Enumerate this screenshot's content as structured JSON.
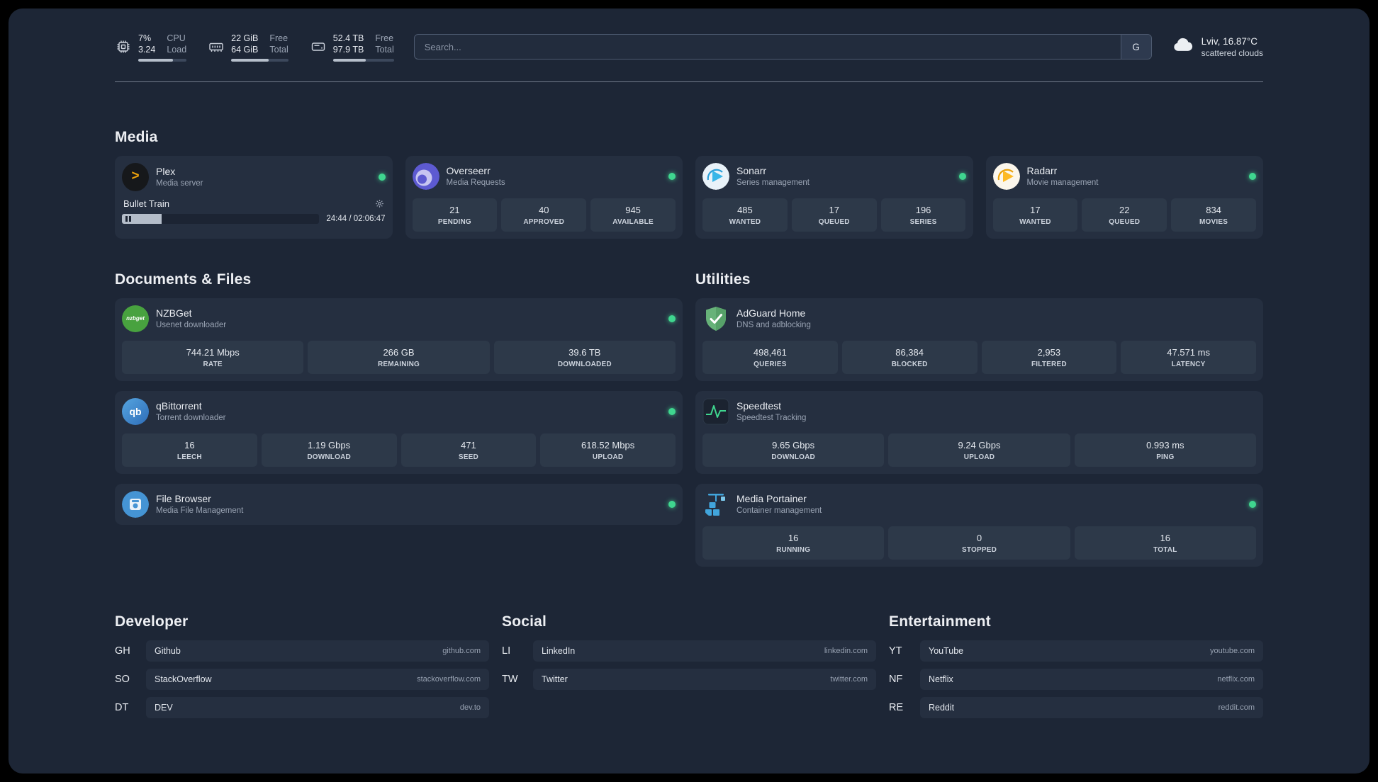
{
  "colors": {
    "status_online": "#3fd68f",
    "plex_accent": "#eba10c"
  },
  "topbar": {
    "cpu": {
      "percent": "7%",
      "load": "3.24",
      "label_top": "CPU",
      "label_bottom": "Load"
    },
    "ram": {
      "free": "22 GiB",
      "total": "64 GiB",
      "label_top": "Free",
      "label_bottom": "Total"
    },
    "disk": {
      "free": "52.4 TB",
      "total": "97.9 TB",
      "label_top": "Free",
      "label_bottom": "Total"
    },
    "search": {
      "placeholder": "Search...",
      "provider": "G"
    },
    "weather": {
      "location": "Lviv, 16.87°C",
      "condition": "scattered clouds"
    }
  },
  "icons": {
    "plex_glyph": ">",
    "nzbget_text": "nzbget",
    "qb_text": "qb"
  },
  "groups": {
    "media": {
      "title": "Media",
      "plex": {
        "name": "Plex",
        "desc": "Media server",
        "now_playing": "Bullet Train",
        "time": "24:44 / 02:06:47"
      },
      "overseerr": {
        "name": "Overseerr",
        "desc": "Media Requests",
        "stats": [
          {
            "value": "21",
            "label": "PENDING"
          },
          {
            "value": "40",
            "label": "APPROVED"
          },
          {
            "value": "945",
            "label": "AVAILABLE"
          }
        ]
      },
      "sonarr": {
        "name": "Sonarr",
        "desc": "Series management",
        "stats": [
          {
            "value": "485",
            "label": "WANTED"
          },
          {
            "value": "17",
            "label": "QUEUED"
          },
          {
            "value": "196",
            "label": "SERIES"
          }
        ]
      },
      "radarr": {
        "name": "Radarr",
        "desc": "Movie management",
        "stats": [
          {
            "value": "17",
            "label": "WANTED"
          },
          {
            "value": "22",
            "label": "QUEUED"
          },
          {
            "value": "834",
            "label": "MOVIES"
          }
        ]
      }
    },
    "documents": {
      "title": "Documents & Files",
      "nzbget": {
        "name": "NZBGet",
        "desc": "Usenet downloader",
        "stats": [
          {
            "value": "744.21 Mbps",
            "label": "RATE"
          },
          {
            "value": "266 GB",
            "label": "REMAINING"
          },
          {
            "value": "39.6 TB",
            "label": "DOWNLOADED"
          }
        ]
      },
      "qbittorrent": {
        "name": "qBittorrent",
        "desc": "Torrent downloader",
        "stats": [
          {
            "value": "16",
            "label": "LEECH"
          },
          {
            "value": "1.19 Gbps",
            "label": "DOWNLOAD"
          },
          {
            "value": "471",
            "label": "SEED"
          },
          {
            "value": "618.52 Mbps",
            "label": "UPLOAD"
          }
        ]
      },
      "filebrowser": {
        "name": "File Browser",
        "desc": "Media File Management"
      }
    },
    "utilities": {
      "title": "Utilities",
      "adguard": {
        "name": "AdGuard Home",
        "desc": "DNS and adblocking",
        "stats": [
          {
            "value": "498,461",
            "label": "QUERIES"
          },
          {
            "value": "86,384",
            "label": "BLOCKED"
          },
          {
            "value": "2,953",
            "label": "FILTERED"
          },
          {
            "value": "47.571 ms",
            "label": "LATENCY"
          }
        ]
      },
      "speedtest": {
        "name": "Speedtest",
        "desc": "Speedtest Tracking",
        "stats": [
          {
            "value": "9.65 Gbps",
            "label": "DOWNLOAD"
          },
          {
            "value": "9.24 Gbps",
            "label": "UPLOAD"
          },
          {
            "value": "0.993 ms",
            "label": "PING"
          }
        ]
      },
      "portainer": {
        "name": "Media Portainer",
        "desc": "Container management",
        "stats": [
          {
            "value": "16",
            "label": "RUNNING"
          },
          {
            "value": "0",
            "label": "STOPPED"
          },
          {
            "value": "16",
            "label": "TOTAL"
          }
        ]
      }
    }
  },
  "bookmarks": {
    "developer": {
      "title": "Developer",
      "items": [
        {
          "abbr": "GH",
          "name": "Github",
          "domain": "github.com"
        },
        {
          "abbr": "SO",
          "name": "StackOverflow",
          "domain": "stackoverflow.com"
        },
        {
          "abbr": "DT",
          "name": "DEV",
          "domain": "dev.to"
        }
      ]
    },
    "social": {
      "title": "Social",
      "items": [
        {
          "abbr": "LI",
          "name": "LinkedIn",
          "domain": "linkedin.com"
        },
        {
          "abbr": "TW",
          "name": "Twitter",
          "domain": "twitter.com"
        }
      ]
    },
    "entertainment": {
      "title": "Entertainment",
      "items": [
        {
          "abbr": "YT",
          "name": "YouTube",
          "domain": "youtube.com"
        },
        {
          "abbr": "NF",
          "name": "Netflix",
          "domain": "netflix.com"
        },
        {
          "abbr": "RE",
          "name": "Reddit",
          "domain": "reddit.com"
        }
      ]
    }
  }
}
